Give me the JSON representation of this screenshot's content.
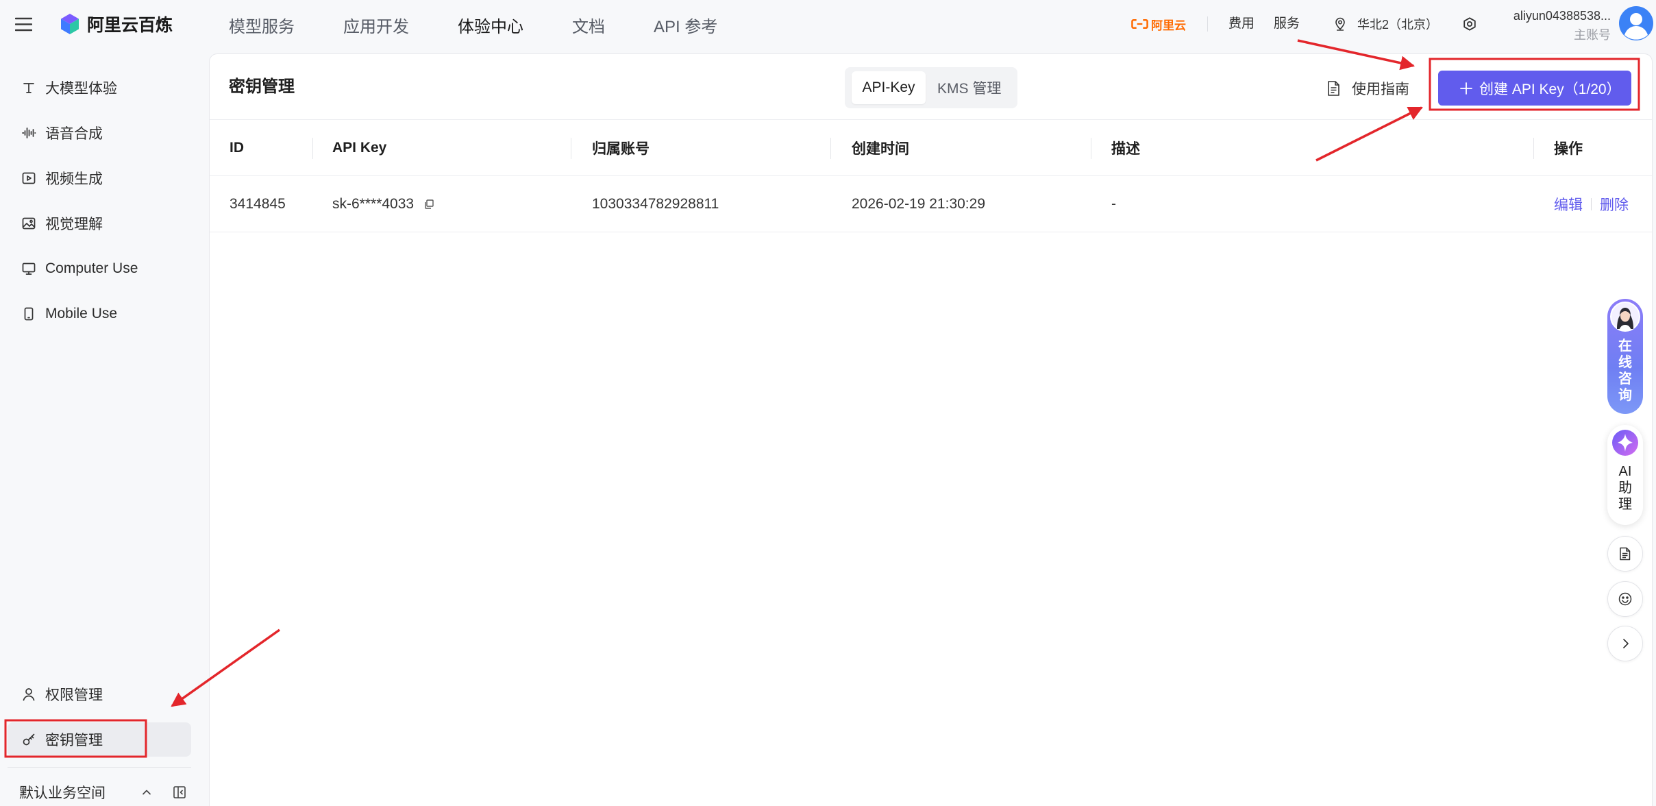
{
  "header": {
    "product_name": "阿里云百炼",
    "nav": [
      {
        "label": "模型服务",
        "active": false
      },
      {
        "label": "应用开发",
        "active": false
      },
      {
        "label": "体验中心",
        "active": true
      },
      {
        "label": "文档",
        "active": false
      },
      {
        "label": "API 参考",
        "active": false
      }
    ],
    "brand_badge": "阿里云",
    "links": {
      "billing": "费用",
      "service": "服务"
    },
    "region": "华北2（北京）",
    "user": {
      "name": "aliyun04388538...",
      "role": "主账号"
    }
  },
  "sidebar": {
    "items": [
      {
        "label": "大模型体验",
        "icon": "text-icon"
      },
      {
        "label": "语音合成",
        "icon": "audio-wave-icon"
      },
      {
        "label": "视频生成",
        "icon": "video-icon"
      },
      {
        "label": "视觉理解",
        "icon": "image-icon"
      },
      {
        "label": "Computer Use",
        "icon": "monitor-icon"
      },
      {
        "label": "Mobile Use",
        "icon": "mobile-icon"
      }
    ],
    "bottom_items": [
      {
        "label": "权限管理",
        "icon": "user-icon",
        "active": false
      },
      {
        "label": "密钥管理",
        "icon": "key-icon",
        "active": true
      }
    ],
    "workspace": "默认业务空间"
  },
  "page": {
    "title": "密钥管理",
    "tabs": [
      {
        "label": "API-Key",
        "active": true
      },
      {
        "label": "KMS 管理",
        "active": false
      }
    ],
    "guide_link": "使用指南",
    "create_button": "创建 API Key（1/20）"
  },
  "table": {
    "columns": [
      "ID",
      "API Key",
      "归属账号",
      "创建时间",
      "描述",
      "操作"
    ],
    "rows": [
      {
        "id": "3414845",
        "api_key": "sk-6****4033",
        "account": "1030334782928811",
        "created_at": "2026-02-19 21:30:29",
        "description": "-",
        "actions": [
          "编辑",
          "删除"
        ]
      }
    ]
  },
  "floating": {
    "consult": "在线咨询",
    "assistant": "AI助理",
    "buttons": [
      {
        "icon": "document-icon"
      },
      {
        "icon": "emoji-icon"
      },
      {
        "icon": "chevron-right-icon"
      }
    ]
  },
  "colors": {
    "accent": "#615ced",
    "brand_orange": "#ff6a00",
    "annotation_red": "#e3262b",
    "avatar_blue": "#3b82f6"
  }
}
